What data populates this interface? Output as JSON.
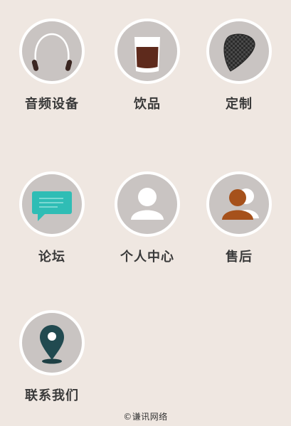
{
  "menu": {
    "items": [
      {
        "label": "音频设备",
        "icon": "headphones-icon"
      },
      {
        "label": "饮品",
        "icon": "drink-cup-icon"
      },
      {
        "label": "定制",
        "icon": "guitar-pick-icon"
      },
      {
        "label": "论坛",
        "icon": "chat-bubble-icon"
      },
      {
        "label": "个人中心",
        "icon": "user-icon"
      },
      {
        "label": "售后",
        "icon": "users-icon"
      },
      {
        "label": "联系我们",
        "icon": "location-pin-icon"
      }
    ]
  },
  "footer": {
    "text": "©谦讯网络"
  },
  "colors": {
    "background": "#efe7e1",
    "circle": "#c9c4c2",
    "teal": "#2fbdb5",
    "brown": "#a6511b",
    "dark_teal": "#214a50"
  }
}
